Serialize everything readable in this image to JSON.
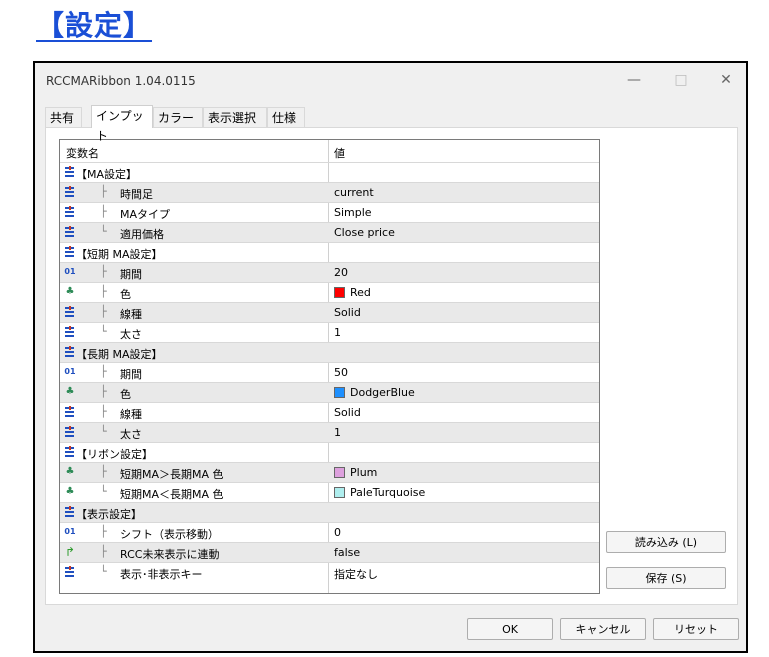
{
  "page_heading": "【設定】",
  "window": {
    "title": "RCCMARibbon 1.04.0115",
    "minimize": "—",
    "maximize": "□",
    "close": "✕"
  },
  "tabs": [
    {
      "label": "共有",
      "active": false
    },
    {
      "label": "インプット",
      "active": true
    },
    {
      "label": "カラー",
      "active": false
    },
    {
      "label": "表示選択",
      "active": false
    },
    {
      "label": "仕様",
      "active": false
    }
  ],
  "grid": {
    "col_name": "変数名",
    "col_value": "値",
    "rows": [
      {
        "icon": "list-icon",
        "tree": "",
        "name": "【MA設定】",
        "value": "",
        "swatch": null
      },
      {
        "icon": "list-icon",
        "tree": "├",
        "name": "時間足",
        "value": "current",
        "swatch": null
      },
      {
        "icon": "list-icon",
        "tree": "├",
        "name": "MAタイプ",
        "value": "Simple",
        "swatch": null
      },
      {
        "icon": "list-icon",
        "tree": "└",
        "name": "適用価格",
        "value": "Close price",
        "swatch": null
      },
      {
        "icon": "list-icon",
        "tree": "",
        "name": "【短期 MA設定】",
        "value": "",
        "swatch": null
      },
      {
        "icon": "integer-icon",
        "tree": "├",
        "name": "期間",
        "value": "20",
        "swatch": null
      },
      {
        "icon": "color-icon",
        "tree": "├",
        "name": "色",
        "value": "Red",
        "swatch": "#ff0000"
      },
      {
        "icon": "list-icon",
        "tree": "├",
        "name": "線種",
        "value": "Solid",
        "swatch": null
      },
      {
        "icon": "list-icon",
        "tree": "└",
        "name": "太さ",
        "value": "1",
        "swatch": null
      },
      {
        "icon": "list-icon",
        "tree": "",
        "name": "【長期 MA設定】",
        "value": "",
        "swatch": null
      },
      {
        "icon": "integer-icon",
        "tree": "├",
        "name": "期間",
        "value": "50",
        "swatch": null
      },
      {
        "icon": "color-icon",
        "tree": "├",
        "name": "色",
        "value": "DodgerBlue",
        "swatch": "#1e90ff"
      },
      {
        "icon": "list-icon",
        "tree": "├",
        "name": "線種",
        "value": "Solid",
        "swatch": null
      },
      {
        "icon": "list-icon",
        "tree": "└",
        "name": "太さ",
        "value": "1",
        "swatch": null
      },
      {
        "icon": "list-icon",
        "tree": "",
        "name": "【リボン設定】",
        "value": "",
        "swatch": null
      },
      {
        "icon": "color-icon",
        "tree": "├",
        "name": "短期MA＞長期MA 色",
        "value": "Plum",
        "swatch": "#dda0dd"
      },
      {
        "icon": "color-icon",
        "tree": "└",
        "name": "短期MA＜長期MA 色",
        "value": "PaleTurquoise",
        "swatch": "#afeeee"
      },
      {
        "icon": "list-icon",
        "tree": "",
        "name": "【表示設定】",
        "value": "",
        "swatch": null
      },
      {
        "icon": "integer-icon",
        "tree": "├",
        "name": "シフト（表示移動）",
        "value": "0",
        "swatch": null
      },
      {
        "icon": "bool-icon",
        "tree": "├",
        "name": "RCC未来表示に連動",
        "value": "false",
        "swatch": null
      },
      {
        "icon": "list-icon",
        "tree": "└",
        "name": "表示･非表示キー",
        "value": "指定なし",
        "swatch": null
      }
    ]
  },
  "buttons": {
    "load": "読み込み (L)",
    "save": "保存 (S)",
    "ok": "OK",
    "cancel": "キャンセル",
    "reset": "リセット"
  }
}
